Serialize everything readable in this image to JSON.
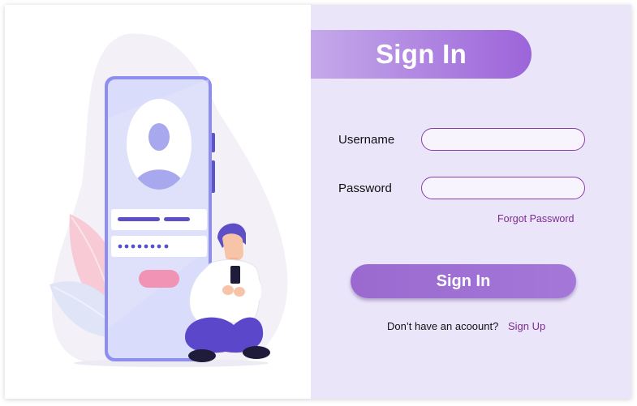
{
  "signin_panel": {
    "title": "Sign In",
    "username_label": "Username",
    "username_value": "",
    "password_label": "Password",
    "password_value": "",
    "forgot_password": "Forgot Password",
    "submit_label": "Sign In",
    "no_account_text": "Don’t have an acoount?",
    "signup_link": "Sign Up"
  },
  "illustration": {
    "password_mask": "●●●●●●●●"
  },
  "colors": {
    "panel_background": "#ebe5fa",
    "accent_purple": "#9c64d9",
    "link_purple": "#7a2d8e",
    "button_purple": "#a074d6"
  }
}
